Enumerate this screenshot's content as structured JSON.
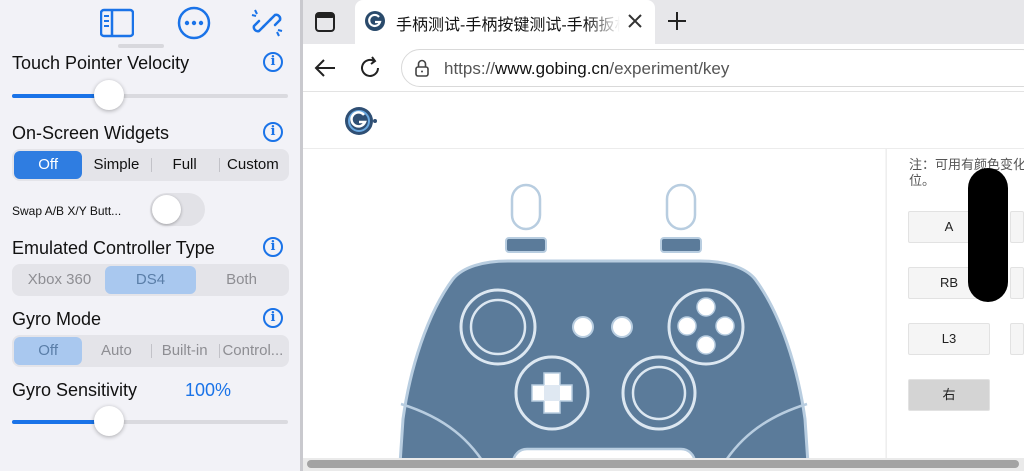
{
  "panel": {
    "touch_pointer_velocity": {
      "label": "Touch Pointer Velocity",
      "value": 0.35
    },
    "on_screen_widgets": {
      "label": "On-Screen Widgets",
      "options": [
        "Off",
        "Simple",
        "Full",
        "Custom"
      ],
      "selected": "Off"
    },
    "swap_ab_xy": {
      "label": "Swap A/B X/Y Butt...",
      "on": false
    },
    "emulated_controller_type": {
      "label": "Emulated Controller Type",
      "options": [
        "Xbox 360",
        "DS4",
        "Both"
      ],
      "selected": "DS4"
    },
    "gyro_mode": {
      "label": "Gyro Mode",
      "options": [
        "Off",
        "Auto",
        "Built-in",
        "Control..."
      ],
      "selected": "Off"
    },
    "gyro_sensitivity": {
      "label": "Gyro Sensitivity",
      "value_text": "100%",
      "value": 0.35
    }
  },
  "browser": {
    "tab_title": "手柄测试-手柄按键测试-手柄扳机",
    "url_scheme": "https://",
    "url_host": "www.gobing.cn",
    "url_path": "/experiment/key",
    "note": "注：可用有颜色变化位。",
    "keys": [
      "A",
      "RB",
      "L3",
      "右"
    ],
    "pressed_key": "右"
  },
  "colors": {
    "accent": "#1a73e8",
    "segment_selected": "#2f7de1",
    "controller_body": "#5b7b9a",
    "controller_outline": "#b8cde0"
  }
}
